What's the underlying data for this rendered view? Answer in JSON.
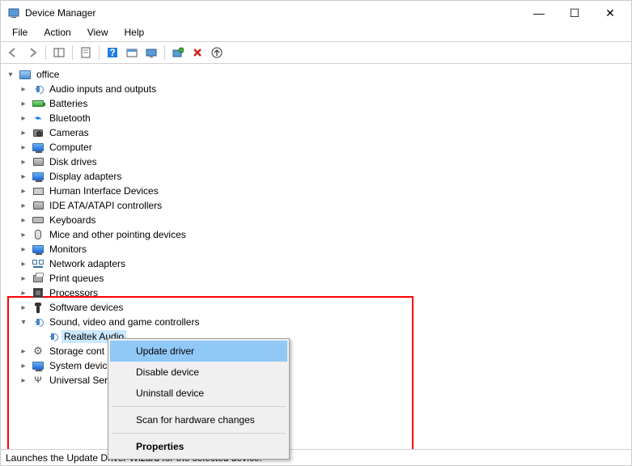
{
  "title": "Device Manager",
  "menus": [
    "File",
    "Action",
    "View",
    "Help"
  ],
  "root": "office",
  "categories": [
    {
      "label": "Audio inputs and outputs",
      "icon": "speaker",
      "expanded": false
    },
    {
      "label": "Batteries",
      "icon": "battery",
      "expanded": false
    },
    {
      "label": "Bluetooth",
      "icon": "bt",
      "expanded": false
    },
    {
      "label": "Cameras",
      "icon": "camera",
      "expanded": false
    },
    {
      "label": "Computer",
      "icon": "monitor",
      "expanded": false
    },
    {
      "label": "Disk drives",
      "icon": "disk",
      "expanded": false
    },
    {
      "label": "Display adapters",
      "icon": "monitor",
      "expanded": false
    },
    {
      "label": "Human Interface Devices",
      "icon": "hid",
      "expanded": false
    },
    {
      "label": "IDE ATA/ATAPI controllers",
      "icon": "disk",
      "expanded": false
    },
    {
      "label": "Keyboards",
      "icon": "keyboard",
      "expanded": false
    },
    {
      "label": "Mice and other pointing devices",
      "icon": "mouse",
      "expanded": false
    },
    {
      "label": "Monitors",
      "icon": "monitor",
      "expanded": false
    },
    {
      "label": "Network adapters",
      "icon": "network",
      "expanded": false
    },
    {
      "label": "Print queues",
      "icon": "printer",
      "expanded": false
    },
    {
      "label": "Processors",
      "icon": "chip",
      "expanded": false
    },
    {
      "label": "Software devices",
      "icon": "software",
      "expanded": false
    },
    {
      "label": "Sound, video and game controllers",
      "icon": "speaker",
      "expanded": true,
      "children": [
        {
          "label": "Realtek Audio",
          "icon": "speaker",
          "selected": true
        }
      ]
    },
    {
      "label": "Storage cont",
      "icon": "gear",
      "expanded": false,
      "truncated": true
    },
    {
      "label": "System devic",
      "icon": "monitor",
      "expanded": false,
      "truncated": true
    },
    {
      "label": "Universal Ser",
      "icon": "usb",
      "expanded": false,
      "truncated": true
    }
  ],
  "context_menu": [
    {
      "label": "Update driver",
      "hover": true
    },
    {
      "label": "Disable device"
    },
    {
      "label": "Uninstall device"
    },
    {
      "sep": true
    },
    {
      "label": "Scan for hardware changes"
    },
    {
      "sep": true
    },
    {
      "label": "Properties",
      "bold": true
    }
  ],
  "status": "Launches the Update Driver Wizard for the selected device."
}
